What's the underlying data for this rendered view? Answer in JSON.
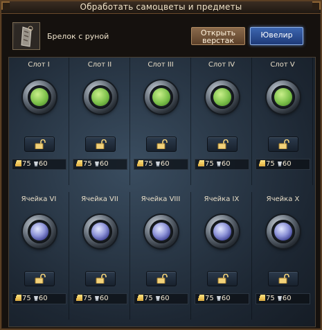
{
  "window": {
    "title": "Обработать самоцветы и предметы"
  },
  "item": {
    "name": "Брелок с руной"
  },
  "buttons": {
    "workbench": "Открыть верстак",
    "jeweler": "Ювелир"
  },
  "colors": {
    "gem_row1": "#7cc04a",
    "gem_row2": "#8e94d8",
    "jeweler_button": "#2a4f96",
    "workbench_button": "#7a5b3f"
  },
  "slots": [
    {
      "label": "Слот I",
      "gem": "green-gem-icon",
      "cost_gold": "75",
      "cost_silver": "60"
    },
    {
      "label": "Слот II",
      "gem": "green-gem-icon",
      "cost_gold": "75",
      "cost_silver": "60"
    },
    {
      "label": "Слот III",
      "gem": "green-gem-icon",
      "cost_gold": "75",
      "cost_silver": "60"
    },
    {
      "label": "Слот IV",
      "gem": "green-gem-icon",
      "cost_gold": "75",
      "cost_silver": "60"
    },
    {
      "label": "Слот V",
      "gem": "green-gem-icon",
      "cost_gold": "75",
      "cost_silver": "60"
    },
    {
      "label": "Ячейка VI",
      "gem": "blue-gem-icon",
      "cost_gold": "75",
      "cost_silver": "60"
    },
    {
      "label": "Ячейка VII",
      "gem": "blue-gem-icon",
      "cost_gold": "75",
      "cost_silver": "60"
    },
    {
      "label": "Ячейка VIII",
      "gem": "blue-gem-icon",
      "cost_gold": "75",
      "cost_silver": "60"
    },
    {
      "label": "Ячейка IX",
      "gem": "blue-gem-icon",
      "cost_gold": "75",
      "cost_silver": "60"
    },
    {
      "label": "Ячейка X",
      "gem": "blue-gem-icon",
      "cost_gold": "75",
      "cost_silver": "60"
    }
  ]
}
